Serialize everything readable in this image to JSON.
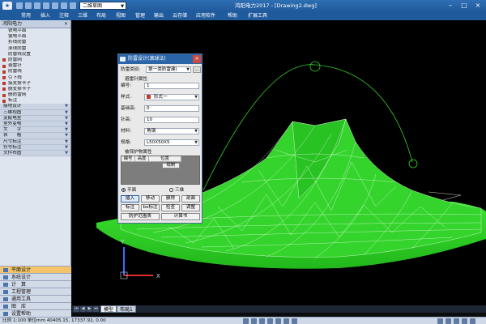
{
  "titlebar": {
    "logo_text": "★",
    "view_select": "二维草图",
    "title": "鸿阳电力2017 - [Drawing2.dwg]",
    "minimize": "–",
    "maximize": "□",
    "close": "×"
  },
  "menu": [
    "常用",
    "插入",
    "注释",
    "三维",
    "布局",
    "视图",
    "管理",
    "输出",
    "云存储",
    "应用软件",
    "帮助",
    "扩展工具"
  ],
  "left_panel": {
    "header": "鸿阳电力",
    "close": "×",
    "items": [
      {
        "label": "铁电平面",
        "kind": "sub"
      },
      {
        "label": "锯电平面",
        "kind": "sub"
      },
      {
        "label": "折线防雷",
        "kind": "sub"
      },
      {
        "label": "滚球防雷",
        "kind": "sub"
      },
      {
        "label": "防雷线设置",
        "kind": "sub"
      },
      {
        "label": "防雷网",
        "kind": "icon"
      },
      {
        "label": "避雷针",
        "kind": "icon"
      },
      {
        "label": "防雷线",
        "kind": "icon"
      },
      {
        "label": "引下线",
        "kind": "icon"
      },
      {
        "label": "接支撑卡子",
        "kind": "icon"
      },
      {
        "label": "删支撑卡子",
        "kind": "icon"
      },
      {
        "label": "删防雷网",
        "kind": "icon"
      },
      {
        "label": "标注",
        "kind": "icon"
      },
      {
        "label": "接地设计",
        "kind": "sec"
      },
      {
        "label": "三维视图",
        "kind": "sec"
      },
      {
        "label": "变配电室",
        "kind": "sec"
      },
      {
        "label": "室外变电",
        "kind": "sec"
      },
      {
        "label": "文　　字",
        "kind": "sec"
      },
      {
        "label": "表　　格",
        "kind": "sec"
      },
      {
        "label": "尺寸标注",
        "kind": "sec"
      },
      {
        "label": "符号标注",
        "kind": "sec"
      },
      {
        "label": "文件布图",
        "kind": "sec"
      }
    ],
    "tabs": [
      {
        "label": "平面设计",
        "active": true
      },
      {
        "label": "系统设计",
        "active": false
      },
      {
        "label": "计　算",
        "active": false
      },
      {
        "label": "工程管理",
        "active": false
      },
      {
        "label": "通用工具",
        "active": false
      },
      {
        "label": "图　库",
        "active": false
      },
      {
        "label": "设置帮助",
        "active": false
      }
    ]
  },
  "dialog": {
    "title": "防雷设计(滚球法)",
    "close": "×",
    "category_label": "防雷类别:",
    "category_value": "第一类防雷建(",
    "dots": "...",
    "group_title": "避雷针属性",
    "number_label": "编号:",
    "number_value": "1",
    "style_label": "样式:",
    "style_value": "形式一",
    "base_label": "基础高:",
    "base_value": "0",
    "needle_label": "针高:",
    "needle_value": "10",
    "material_label": "材料:",
    "material_value": "角钢",
    "spec_label": "规格:",
    "spec_value": "L50X50X5",
    "protected_title": "被保护物属性",
    "table_headers": [
      "编号",
      "高度",
      "位置"
    ],
    "table_button": "绘制",
    "radio_plane": "平面",
    "radio_3d": "三维",
    "buttons_row1": [
      "插入",
      "移动",
      "删除",
      "剖面"
    ],
    "buttons_row2": [
      "标注",
      "bx标注",
      "检查",
      "调整"
    ],
    "buttons_row3": [
      "防护范围表",
      "计算书"
    ]
  },
  "canvas": {
    "axis_y": "Y",
    "axis_x": "X"
  },
  "canvas_tabs": {
    "tabs": [
      "模型",
      "布局1"
    ]
  },
  "status": {
    "text": "比例 1:100   单位mm  40405.15, 17337.92, 0.00"
  },
  "colors": {
    "title_bg": "#2f6fb3",
    "mesh_green": "#35d42c",
    "accent": "#2a65a8"
  }
}
